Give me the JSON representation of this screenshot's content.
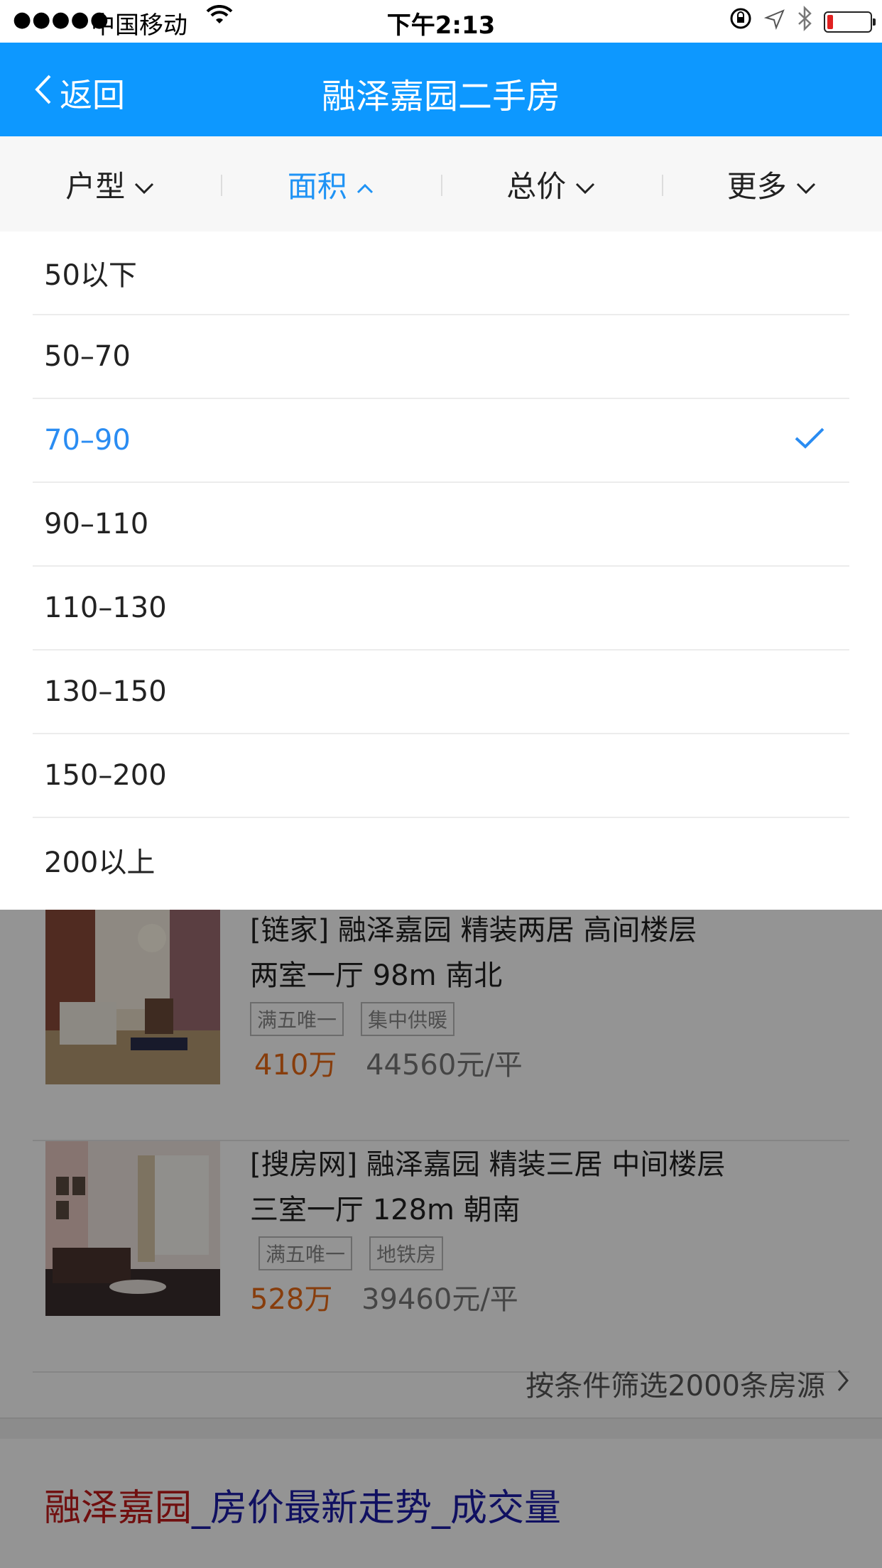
{
  "status_bar": {
    "signal": "●●●●●",
    "carrier": "中国移动",
    "time": "下午2:13"
  },
  "nav": {
    "back_label": "返回",
    "title": "融泽嘉园二手房"
  },
  "filters": {
    "items": [
      {
        "label": "户型",
        "state": "collapsed"
      },
      {
        "label": "面积",
        "state": "expanded"
      },
      {
        "label": "总价",
        "state": "collapsed"
      },
      {
        "label": "更多",
        "state": "collapsed"
      }
    ]
  },
  "area_options": {
    "selected_index": 2,
    "items": [
      "50以下",
      "50–70",
      "70–90",
      "90–110",
      "110–130",
      "130–150",
      "150–200",
      "200以上"
    ]
  },
  "listings": [
    {
      "title": "[链家] 融泽嘉园  精装两居  高间楼层",
      "layout": "两室一厅  98m  南北",
      "tags": [
        "满五唯一",
        "集中供暖"
      ],
      "price": "410万",
      "unit_price": "44560元/平"
    },
    {
      "title": "[搜房网] 融泽嘉园  精装三居  中间楼层",
      "layout": "三室一厅  128m  朝南",
      "tags": [
        "满五唯一",
        "地铁房"
      ],
      "price": "528万",
      "unit_price": "39460元/平"
    }
  ],
  "more_link": "按条件筛选2000条房源",
  "bottom_link": {
    "part1": "融泽嘉园",
    "part2": "_房价最新走势_成交量"
  },
  "colors": {
    "nav_bg": "#0d98ff",
    "active": "#1f93f5",
    "price": "#e86a16"
  }
}
